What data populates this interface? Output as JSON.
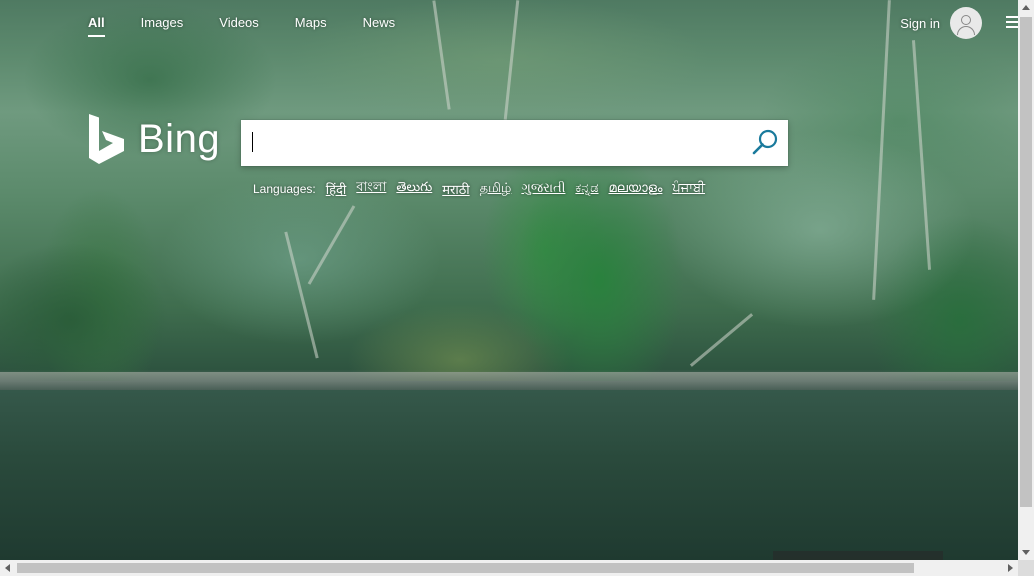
{
  "nav": {
    "tabs": [
      {
        "label": "All",
        "active": true
      },
      {
        "label": "Images",
        "active": false
      },
      {
        "label": "Videos",
        "active": false
      },
      {
        "label": "Maps",
        "active": false
      },
      {
        "label": "News",
        "active": false
      }
    ],
    "sign_in_label": "Sign in",
    "avatar_icon": "person-icon",
    "menu_icon": "hamburger-menu-icon"
  },
  "logo": {
    "wordmark": "Bing",
    "mark_icon": "bing-logo-icon"
  },
  "search": {
    "value": "",
    "placeholder": "",
    "button_icon": "search-icon"
  },
  "languages": {
    "label": "Languages:",
    "items": [
      "हिंदी",
      "বাংলা",
      "తెలుగు",
      "मराठी",
      "தமிழ்",
      "ગુજરાતી",
      "ಕನ್ನಡ",
      "മലയാളം",
      "ਪੰਜਾਬੀ"
    ]
  },
  "colors": {
    "text_on_image": "#ffffff",
    "search_icon": "#1a7a9c",
    "scrollbar_track": "#f0f0f0",
    "scrollbar_thumb": "#c2c2c2"
  }
}
